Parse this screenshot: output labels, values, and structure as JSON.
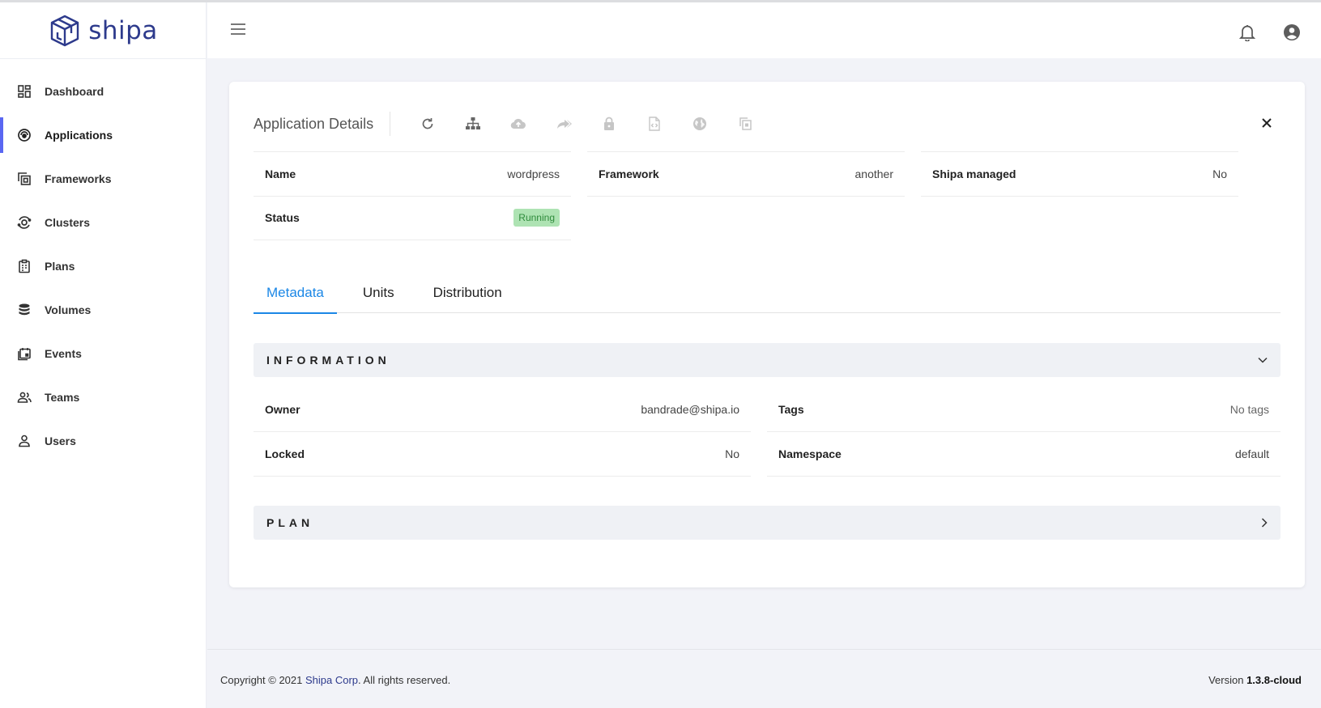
{
  "app": {
    "name": "shipa"
  },
  "sidebar": {
    "items": [
      {
        "label": "Dashboard",
        "icon": "dashboard-icon"
      },
      {
        "label": "Applications",
        "icon": "applications-icon",
        "active": true
      },
      {
        "label": "Frameworks",
        "icon": "frameworks-icon"
      },
      {
        "label": "Clusters",
        "icon": "clusters-icon"
      },
      {
        "label": "Plans",
        "icon": "plans-icon"
      },
      {
        "label": "Volumes",
        "icon": "volumes-icon"
      },
      {
        "label": "Events",
        "icon": "events-icon"
      },
      {
        "label": "Teams",
        "icon": "teams-icon"
      },
      {
        "label": "Users",
        "icon": "users-icon"
      }
    ]
  },
  "header": {
    "icons": [
      "menu-icon",
      "bell-icon",
      "account-icon"
    ]
  },
  "details": {
    "title": "Application Details",
    "toolbar_icons": [
      "refresh-icon",
      "hierarchy-icon",
      "cloud-upload-icon",
      "forward-icon",
      "lock-icon",
      "file-code-icon",
      "globe-icon",
      "copy-icon"
    ],
    "name_label": "Name",
    "name_value": "wordpress",
    "framework_label": "Framework",
    "framework_value": "another",
    "shipa_managed_label": "Shipa managed",
    "shipa_managed_value": "No",
    "status_label": "Status",
    "status_value": "Running",
    "status_color": "#aee3b3"
  },
  "tabs": [
    {
      "label": "Metadata",
      "active": true
    },
    {
      "label": "Units"
    },
    {
      "label": "Distribution"
    }
  ],
  "information": {
    "title": "INFORMATION",
    "owner_label": "Owner",
    "owner_value": "bandrade@shipa.io",
    "tags_label": "Tags",
    "tags_value": "No tags",
    "locked_label": "Locked",
    "locked_value": "No",
    "namespace_label": "Namespace",
    "namespace_value": "default"
  },
  "plan": {
    "title": "PLAN"
  },
  "footer": {
    "copyright_prefix": "Copyright © 2021 ",
    "company": "Shipa Corp",
    "copyright_suffix": ". All rights reserved.",
    "version_label": "Version ",
    "version_value": "1.3.8-cloud"
  },
  "colors": {
    "accent": "#1b87e6",
    "brand": "#2d3a8c",
    "active_indicator": "#5a67f2"
  }
}
